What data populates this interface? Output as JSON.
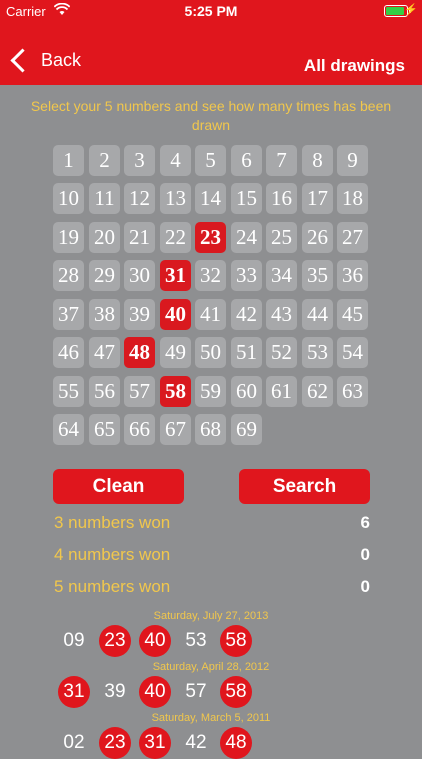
{
  "status_bar": {
    "carrier": "Carrier",
    "time": "5:25 PM"
  },
  "nav": {
    "back_label": "Back",
    "title": "All drawings"
  },
  "instructions": "Select your 5 numbers and see how many times has been drawn",
  "numbers": [
    1,
    2,
    3,
    4,
    5,
    6,
    7,
    8,
    9,
    10,
    11,
    12,
    13,
    14,
    15,
    16,
    17,
    18,
    19,
    20,
    21,
    22,
    23,
    24,
    25,
    26,
    27,
    28,
    29,
    30,
    31,
    32,
    33,
    34,
    35,
    36,
    37,
    38,
    39,
    40,
    41,
    42,
    43,
    44,
    45,
    46,
    47,
    48,
    49,
    50,
    51,
    52,
    53,
    54,
    55,
    56,
    57,
    58,
    59,
    60,
    61,
    62,
    63,
    64,
    65,
    66,
    67,
    68,
    69
  ],
  "selected": [
    23,
    31,
    40,
    48,
    58
  ],
  "buttons": {
    "clean": "Clean",
    "search": "Search"
  },
  "stats": [
    {
      "label": "3 numbers won",
      "value": "6"
    },
    {
      "label": "4 numbers won",
      "value": "0"
    },
    {
      "label": "5 numbers won",
      "value": "0"
    }
  ],
  "drawings": [
    {
      "date": "Saturday, July 27, 2013",
      "numbers": [
        "09",
        "23",
        "40",
        "53",
        "58"
      ]
    },
    {
      "date": "Saturday, April 28, 2012",
      "numbers": [
        "31",
        "39",
        "40",
        "57",
        "58"
      ]
    },
    {
      "date": "Saturday, March 5, 2011",
      "numbers": [
        "02",
        "23",
        "31",
        "42",
        "48"
      ]
    }
  ],
  "colors": {
    "accent": "#e0161d",
    "background": "#8e8f91",
    "cell": "#a7a8aa",
    "label": "#f1c74c"
  }
}
